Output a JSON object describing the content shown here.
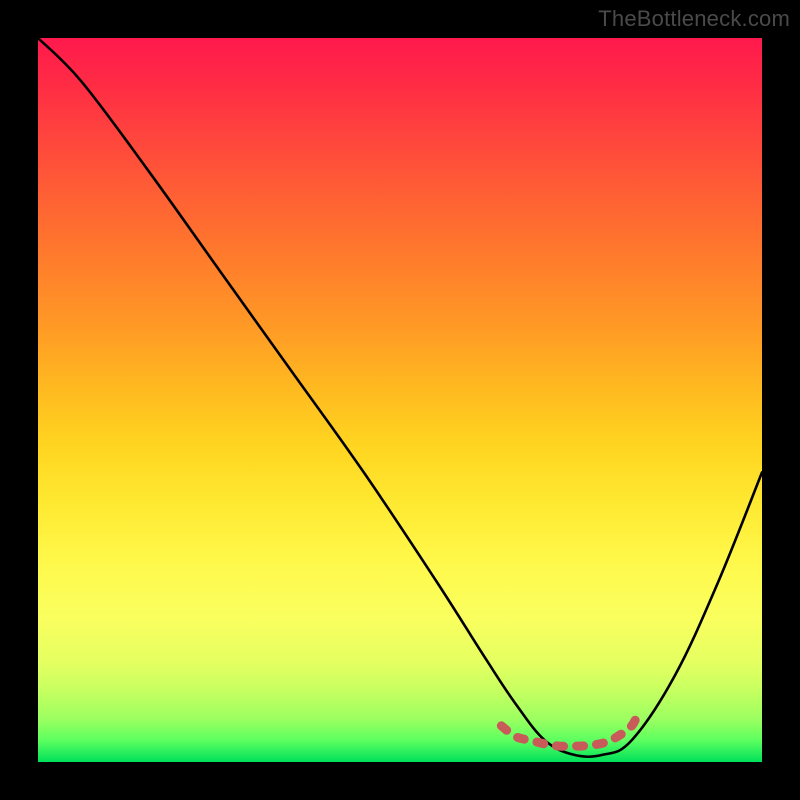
{
  "watermark": "TheBottleneck.com",
  "chart_data": {
    "type": "line",
    "title": "",
    "xlabel": "",
    "ylabel": "",
    "xlim": [
      0,
      100
    ],
    "ylim": [
      0,
      100
    ],
    "series": [
      {
        "name": "bottleneck-curve",
        "x": [
          0,
          6,
          15,
          25,
          35,
          45,
          55,
          62,
          66,
          70,
          74,
          78,
          82,
          88,
          94,
          100
        ],
        "values": [
          100,
          94,
          82,
          68,
          54,
          40,
          25,
          14,
          8,
          3,
          1,
          1,
          3,
          12,
          25,
          40
        ]
      },
      {
        "name": "optimal-marker",
        "x": [
          64,
          66,
          68,
          70,
          72,
          74,
          75,
          76,
          78,
          80,
          82,
          83
        ],
        "values": [
          5,
          3.5,
          3,
          2.5,
          2.2,
          2.2,
          2.2,
          2.3,
          2.6,
          3.5,
          5,
          7
        ]
      }
    ],
    "colors": {
      "curve": "#000000",
      "marker": "#c95a5a",
      "gradient_top": "#ff1a4d",
      "gradient_bottom": "#00e05a"
    }
  }
}
